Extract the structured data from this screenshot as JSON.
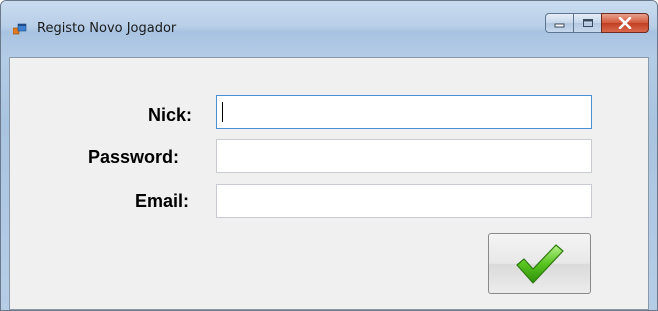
{
  "window": {
    "title": "Registo Novo Jogador",
    "caption_icons": [
      "minimize-icon",
      "maximize-icon",
      "close-icon"
    ]
  },
  "form": {
    "nick_label": "Nick:",
    "nick_value": "",
    "password_label": "Password:",
    "password_value": "",
    "email_label": "Email:",
    "email_value": "",
    "submit_icon": "checkmark-icon"
  },
  "colors": {
    "close_button": "#c9442a",
    "checkmark": "#46b51a",
    "focus_border": "#4a90d6"
  }
}
